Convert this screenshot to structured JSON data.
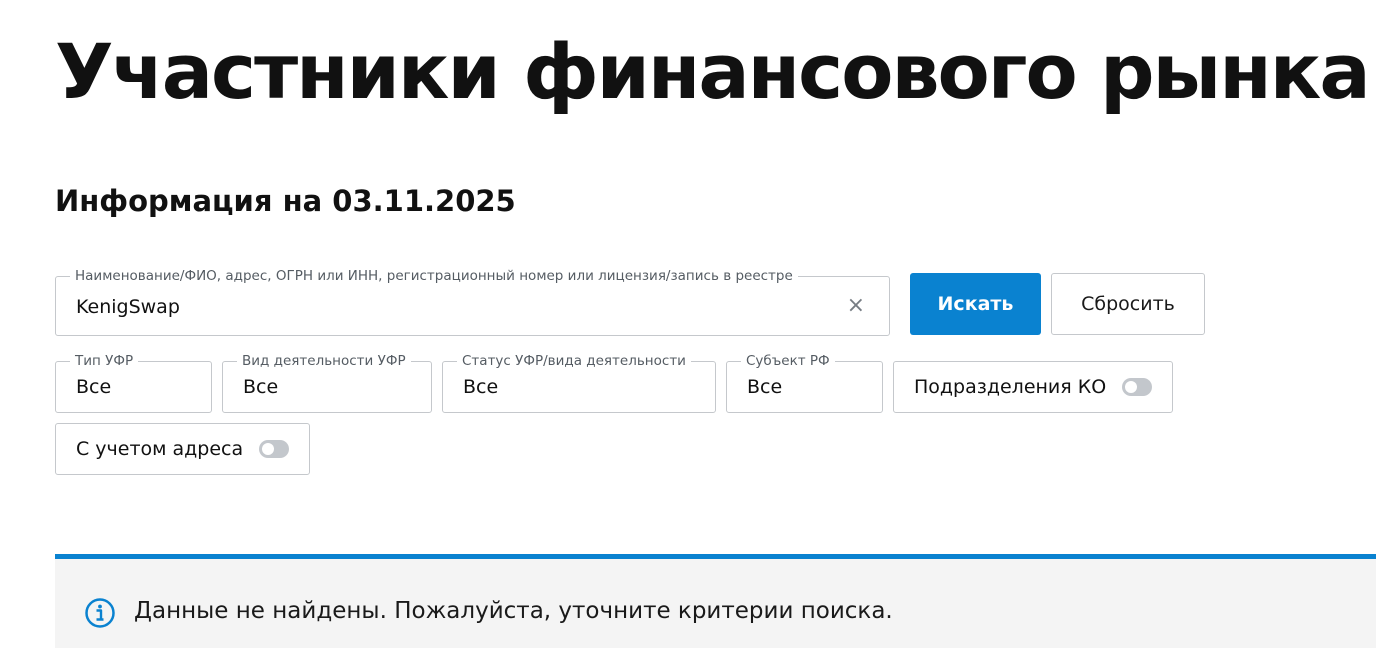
{
  "page": {
    "title": "Участники финансового рынка",
    "info_date": "Информация на 03.11.2025"
  },
  "search": {
    "label": "Наименование/ФИО, адрес, ОГРН или ИНН, регистрационный номер или лицензия/запись в реестре",
    "value": "KenigSwap",
    "clear_symbol": "×",
    "submit_label": "Искать",
    "reset_label": "Сбросить"
  },
  "filters": {
    "ufr_type": {
      "label": "Тип УФР",
      "value": "Все"
    },
    "activity_type": {
      "label": "Вид деятельности УФР",
      "value": "Все"
    },
    "status": {
      "label": "Статус УФР/вида деятельности",
      "value": "Все"
    },
    "region": {
      "label": "Субъект РФ",
      "value": "Все"
    },
    "subdivisions": {
      "label": "Подразделения КО",
      "enabled": false
    },
    "with_address": {
      "label": "С учетом адреса",
      "enabled": false
    }
  },
  "notice": {
    "icon": "info-icon",
    "text": "Данные не найдены. Пожалуйста, уточните критерии поиска."
  },
  "colors": {
    "accent": "#0a82d0",
    "notice_bg": "#f4f4f4",
    "border": "#c5c8cc"
  }
}
